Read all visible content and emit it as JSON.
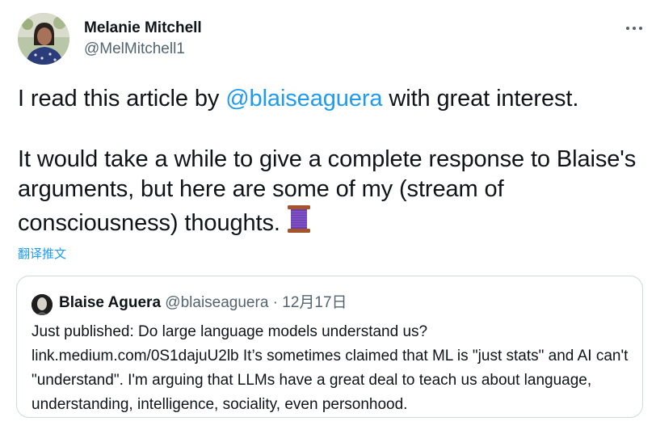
{
  "author": {
    "name": "Melanie Mitchell",
    "handle": "@MelMitchell1"
  },
  "tweet": {
    "line1_before": "I read this article by ",
    "mention": "@blaiseaguera",
    "line1_after": " with great interest.",
    "para2": "It would take a while to give a complete response to Blaise's arguments, but here are some of my (stream of consciousness) thoughts.",
    "emoji_icon": "thread-spool-icon"
  },
  "translate_label": "翻译推文",
  "quote": {
    "name": "Blaise Aguera",
    "handle": "@blaiseaguera",
    "separator": "·",
    "date": "12月17日",
    "text": "Just published: Do large language models understand us? link.medium.com/0S1dajuU2lb It’s sometimes claimed that ML is \"just stats\" and AI can't \"understand\". I'm arguing that LLMs have a great deal to teach us about language, understanding, intelligence, sociality, even personhood."
  },
  "colors": {
    "link": "#1d9bf0",
    "text": "#0f1419",
    "secondary": "#536471",
    "border": "#cfd9de"
  }
}
